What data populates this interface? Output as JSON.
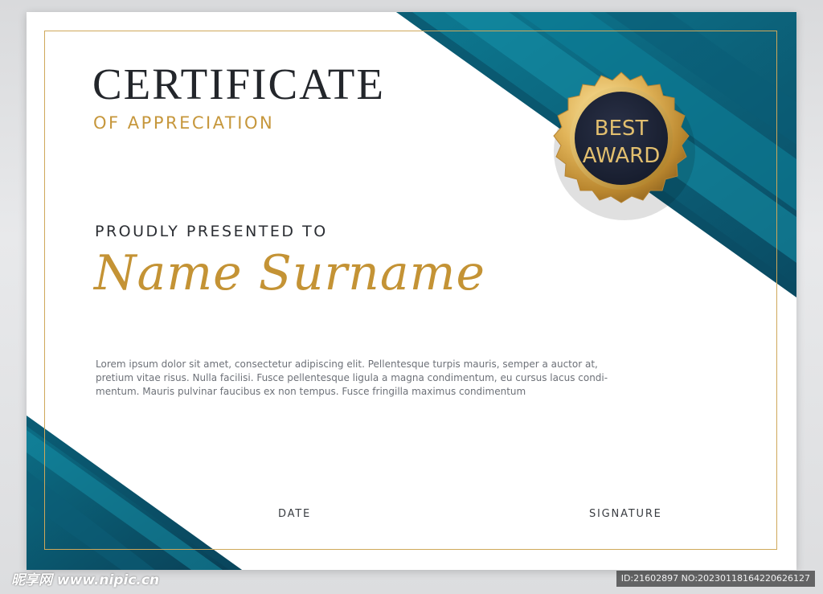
{
  "certificate": {
    "title": "CERTIFICATE",
    "subtitle": "OF APPRECIATION",
    "presented_label": "PROUDLY PRESENTED TO",
    "recipient_name": "Name Surname",
    "body_lines": [
      "Lorem ipsum dolor sit amet, consectetur adipiscing elit. Pellentesque turpis mauris, semper a auctor at,",
      "pretium vitae risus. Nulla facilisi. Fusce pellentesque ligula a magna condimentum, eu cursus lacus condi-",
      "mentum. Mauris pulvinar faucibus ex non tempus. Fusce fringilla maximus condimentum"
    ],
    "date_label": "DATE",
    "signature_label": "SIGNATURE"
  },
  "badge": {
    "line1": "BEST",
    "line2": "AWARD"
  },
  "watermark": {
    "logo": "昵享网 www.nipic.cn",
    "id": "ID:21602897 NO:20230118164220626127"
  },
  "colors": {
    "teal_dark": "#0b4f66",
    "teal": "#0f7189",
    "gold": "#c6973c",
    "navy": "#1a2032",
    "text_dark": "#23262b",
    "text_muted": "#6d7178"
  }
}
